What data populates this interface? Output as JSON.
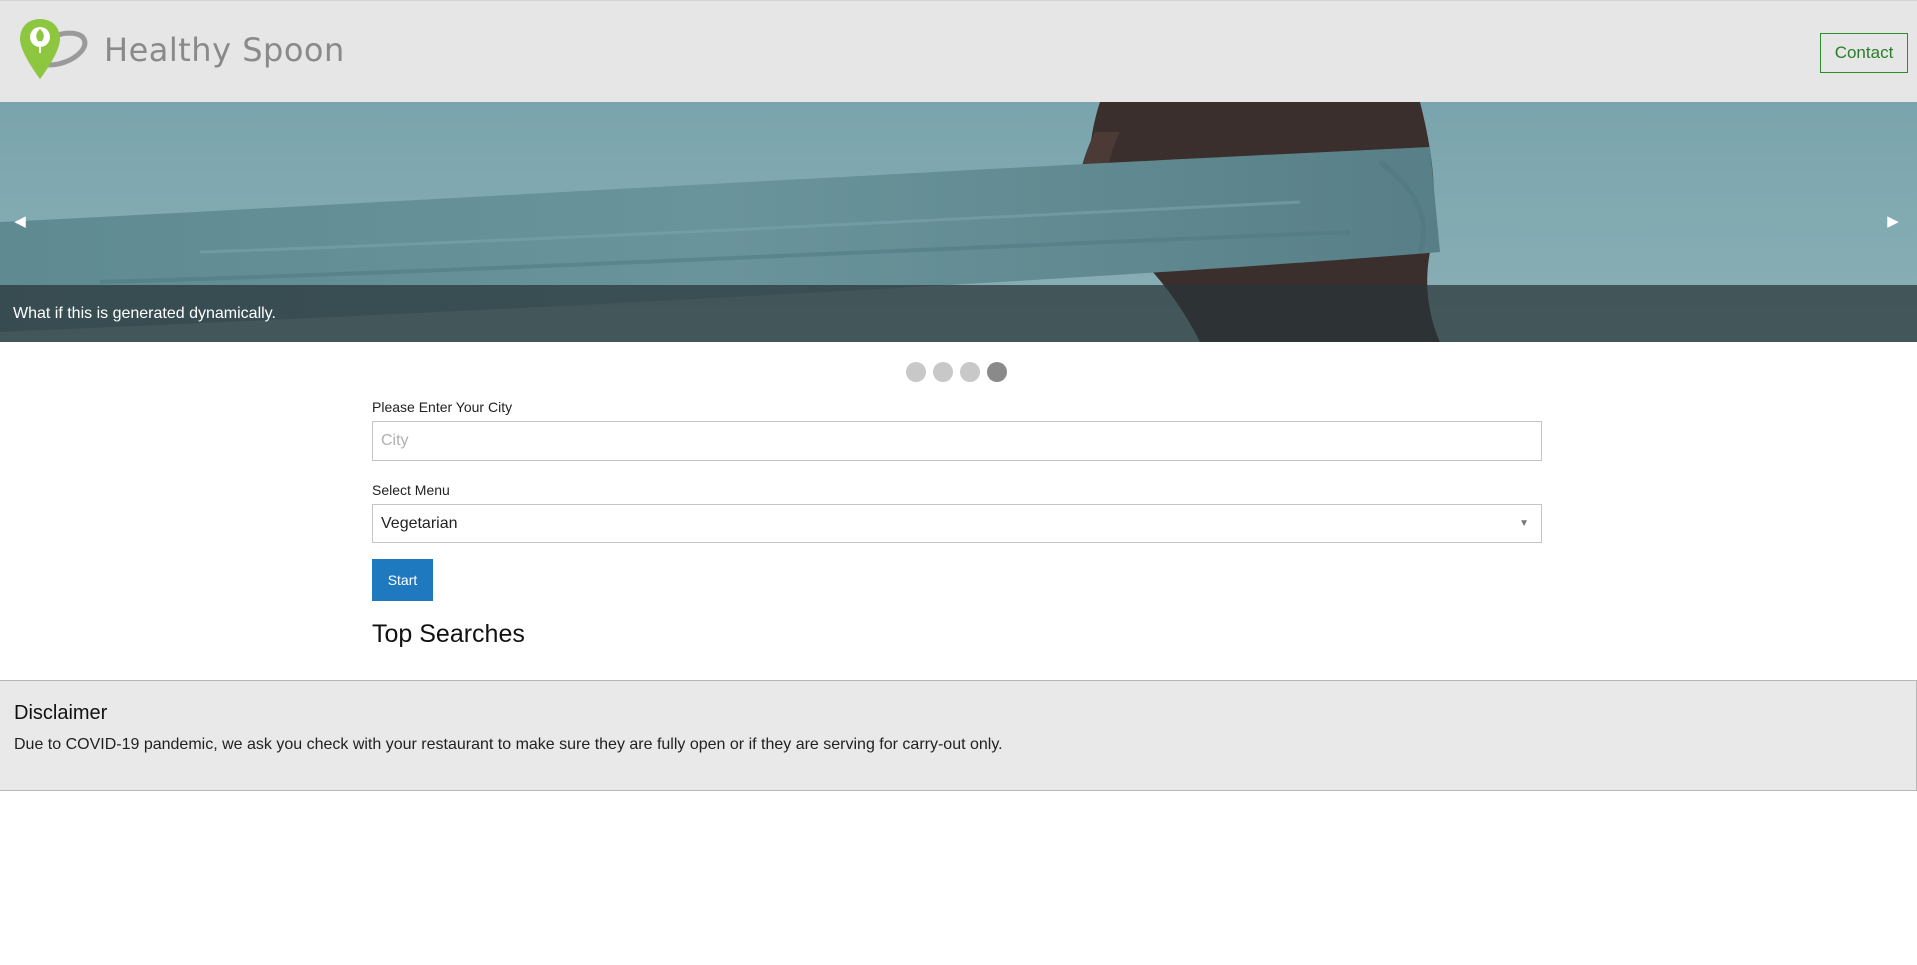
{
  "header": {
    "brand": "Healthy Spoon",
    "contact_label": "Contact",
    "logo_icon": "map-pin-leaf-logo",
    "brand_color": "#8dc63f"
  },
  "carousel": {
    "caption": "What if this is generated dynamically.",
    "prev_icon": "triangle-left",
    "next_icon": "triangle-right",
    "slide_count": 4,
    "active_slide": 4
  },
  "form": {
    "city_label": "Please Enter Your City",
    "city_placeholder": "City",
    "city_value": "",
    "menu_label": "Select Menu",
    "menu_selected": "Vegetarian",
    "start_label": "Start"
  },
  "top_searches": {
    "heading": "Top Searches"
  },
  "disclaimer": {
    "title": "Disclaimer",
    "text": "Due to COVID-19 pandemic, we ask you check with your restaurant to make sure they are fully open or if they are serving for carry-out only."
  }
}
